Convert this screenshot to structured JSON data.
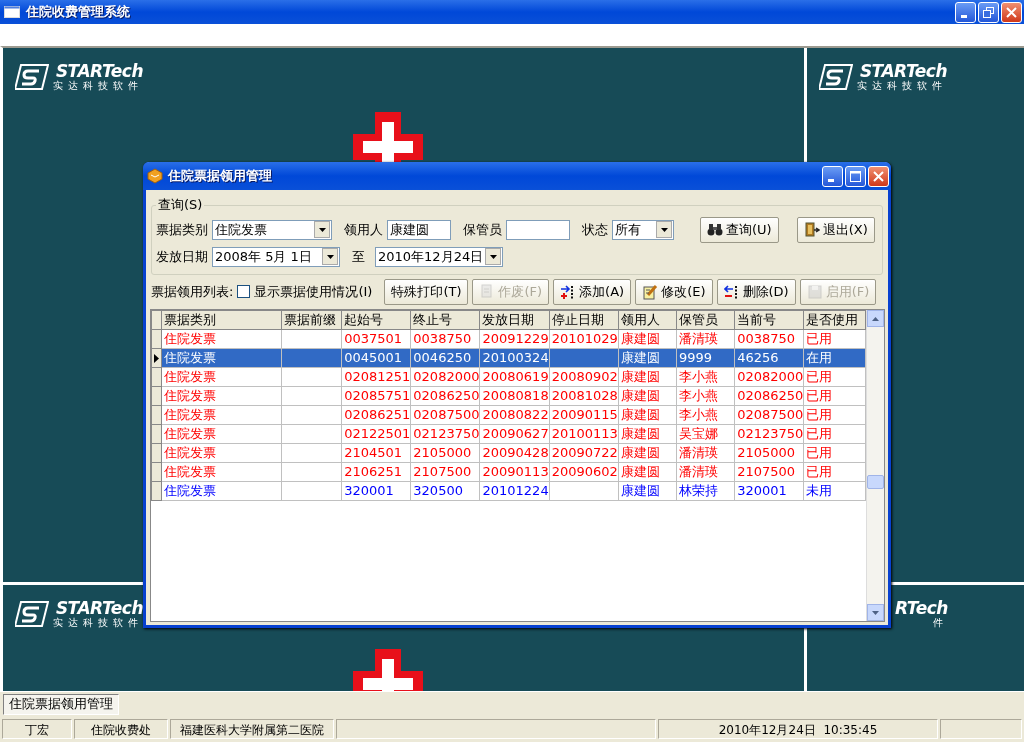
{
  "window": {
    "title": "住院收费管理系统"
  },
  "desktop": {
    "tiles": [
      {
        "logo": "STARTech",
        "logo_sub": "实达科技软件",
        "emblem": true,
        "cross": true
      },
      {
        "logo": "STARTech",
        "logo_sub": "实达科技软件",
        "emblem": true,
        "cross": false
      },
      {
        "logo": "STARTech",
        "logo_sub": "实达科技软件",
        "emblem": true,
        "cross": true
      },
      {
        "logo": "RTech",
        "logo_sub": "件",
        "emblem": false,
        "cross": false
      }
    ]
  },
  "dialog": {
    "title": "住院票据领用管理",
    "query": {
      "legend": "查询(S)",
      "fields": [
        {
          "kind": "combo",
          "label": "票据类别",
          "value": "住院发票"
        },
        {
          "kind": "text",
          "label": "领用人",
          "value": "康建圆"
        },
        {
          "kind": "text",
          "label": "保管员"
        },
        {
          "kind": "combo",
          "label": "状态",
          "value": "所有"
        }
      ],
      "buttons": [
        {
          "label": "查询(U)"
        },
        {
          "label": "退出(X)"
        }
      ],
      "dates": [
        {
          "kind": "date",
          "label": "发放日期",
          "value": "2008年 5月 1日"
        },
        {
          "kind": "date",
          "label": "至",
          "value": "2010年12月24日"
        }
      ]
    },
    "toolbar": {
      "label": "票据领用列表:",
      "checkbox": {
        "label": "显示票据使用情况(I)",
        "checked": false
      },
      "buttons": [
        {
          "label": "特殊打印(T)",
          "disabled": false
        },
        {
          "label": "作废(F)",
          "disabled": true
        },
        {
          "label": "添加(A)",
          "disabled": false
        },
        {
          "label": "修改(E)",
          "disabled": false
        },
        {
          "label": "删除(D)",
          "disabled": false
        },
        {
          "label": "启用(F)",
          "disabled": true
        }
      ]
    },
    "table": {
      "columns": [
        "票据类别",
        "票据前缀",
        "起始号",
        "终止号",
        "发放日期",
        "停止日期",
        "领用人",
        "保管员",
        "当前号",
        "是否使用"
      ],
      "rows": [
        {
          "selected": false,
          "kind": "used",
          "cells": [
            "住院发票",
            "",
            "0037501",
            "0038750",
            "20091229",
            "20101029",
            "康建圆",
            "潘清瑛",
            "0038750",
            "已用"
          ]
        },
        {
          "selected": true,
          "cells": [
            "住院发票",
            "",
            "0045001",
            "0046250",
            "20100324",
            "",
            "康建圆",
            "9999",
            "46256",
            "在用"
          ]
        },
        {
          "selected": false,
          "kind": "used",
          "cells": [
            "住院发票",
            "",
            "02081251",
            "02082000",
            "20080619",
            "20080902",
            "康建圆",
            "李小燕",
            "02082000",
            "已用"
          ]
        },
        {
          "selected": false,
          "kind": "used",
          "cells": [
            "住院发票",
            "",
            "02085751",
            "02086250",
            "20080818",
            "20081028",
            "康建圆",
            "李小燕",
            "02086250",
            "已用"
          ]
        },
        {
          "selected": false,
          "kind": "used",
          "cells": [
            "住院发票",
            "",
            "02086251",
            "02087500",
            "20080822",
            "20090115",
            "康建圆",
            "李小燕",
            "02087500",
            "已用"
          ]
        },
        {
          "selected": false,
          "kind": "used",
          "cells": [
            "住院发票",
            "",
            "02122501",
            "02123750",
            "20090627",
            "20100113",
            "康建圆",
            "吴宝娜",
            "02123750",
            "已用"
          ]
        },
        {
          "selected": false,
          "kind": "used",
          "cells": [
            "住院发票",
            "",
            "2104501",
            "2105000",
            "20090428",
            "20090722",
            "康建圆",
            "潘清瑛",
            "2105000",
            "已用"
          ]
        },
        {
          "selected": false,
          "kind": "used",
          "cells": [
            "住院发票",
            "",
            "2106251",
            "2107500",
            "20090113",
            "20090602",
            "康建圆",
            "潘清瑛",
            "2107500",
            "已用"
          ]
        },
        {
          "selected": false,
          "kind": "unused",
          "cells": [
            "住院发票",
            "",
            "320001",
            "320500",
            "20101224",
            "",
            "康建圆",
            "林荣持",
            "320001",
            "未用"
          ]
        }
      ]
    }
  },
  "taskbar": {
    "tabs": [
      {
        "label": "住院票据领用管理",
        "selected": true
      }
    ]
  },
  "status_bar": {
    "panels": [
      "丁宏",
      "住院收费处",
      "福建医科大学附属第二医院",
      "2010年12月24日  10:35:45"
    ]
  }
}
